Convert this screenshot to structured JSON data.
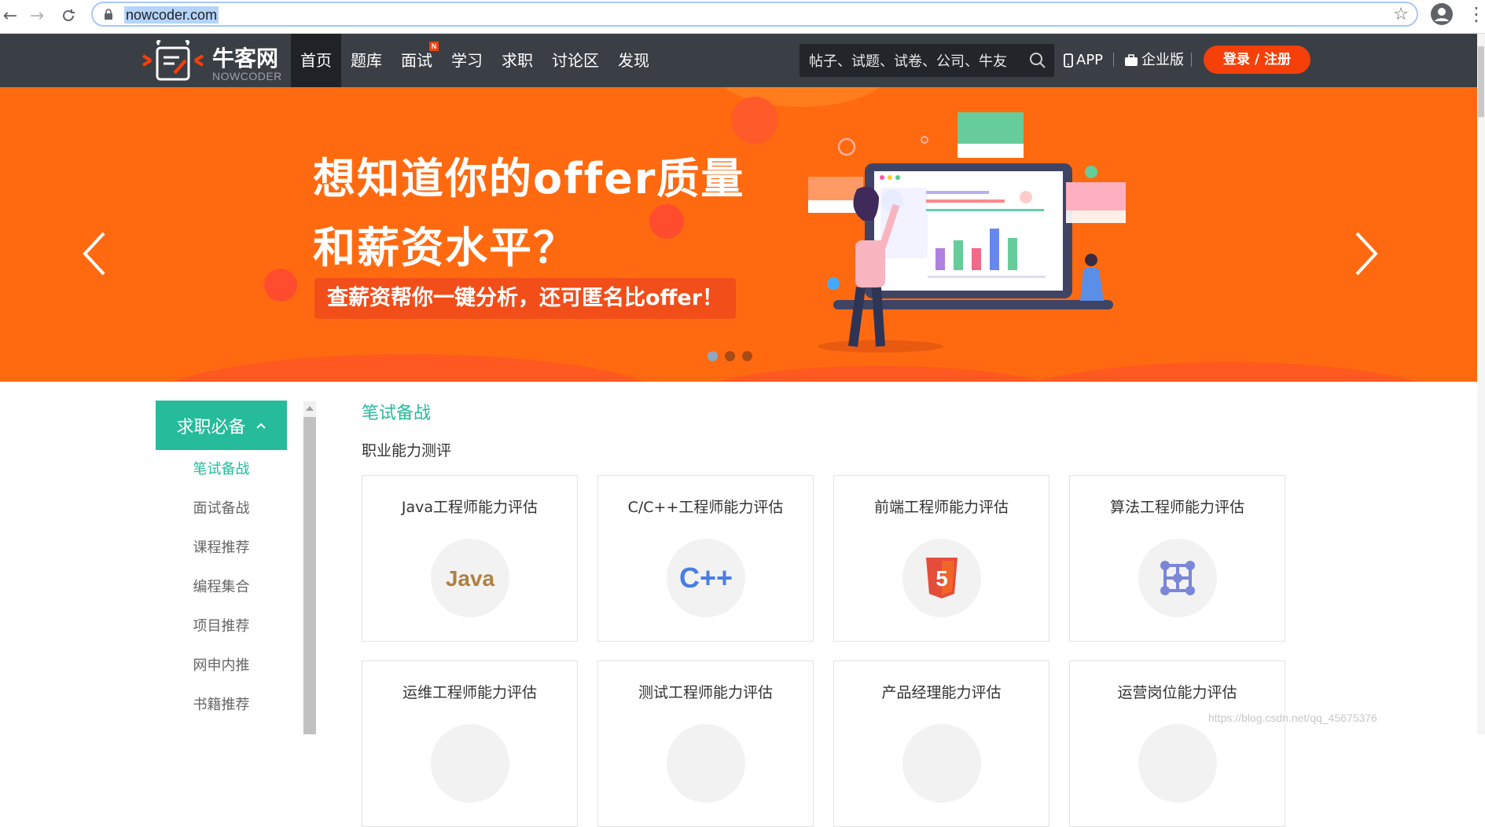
{
  "browser": {
    "url": "nowcoder.com"
  },
  "header": {
    "brand_cn": "牛客网",
    "brand_en": "NOWCODER",
    "nav": [
      {
        "label": "首页",
        "active": true
      },
      {
        "label": "题库"
      },
      {
        "label": "面试",
        "badge": "N"
      },
      {
        "label": "学习"
      },
      {
        "label": "求职"
      },
      {
        "label": "讨论区"
      },
      {
        "label": "发现"
      }
    ],
    "search_placeholder": "帖子、试题、试卷、公司、牛友",
    "app_label": "APP",
    "enterprise_label": "企业版",
    "login_label": "登录 / 注册"
  },
  "banner": {
    "headline_1": "想知道你的offer质量",
    "headline_2": "和薪资水平？",
    "cta": "查薪资帮你一键分析，还可匿名比offer！",
    "dots": 3,
    "active_dot": 0
  },
  "sidebar": {
    "section_title": "求职必备",
    "items": [
      {
        "label": "笔试备战",
        "active": true
      },
      {
        "label": "面试备战"
      },
      {
        "label": "课程推荐"
      },
      {
        "label": "编程集合"
      },
      {
        "label": "项目推荐"
      },
      {
        "label": "网申内推"
      },
      {
        "label": "书籍推荐"
      }
    ]
  },
  "content": {
    "section_title": "笔试备战",
    "subsection_title": "职业能力测评",
    "cards": [
      {
        "title": "Java工程师能力评估",
        "icon": "java-icon"
      },
      {
        "title": "C/C++工程师能力评估",
        "icon": "cpp-icon"
      },
      {
        "title": "前端工程师能力评估",
        "icon": "html5-icon"
      },
      {
        "title": "算法工程师能力评估",
        "icon": "algorithm-icon"
      },
      {
        "title": "运维工程师能力评估",
        "icon": "ops-icon"
      },
      {
        "title": "测试工程师能力评估",
        "icon": "test-icon"
      },
      {
        "title": "产品经理能力评估",
        "icon": "product-icon"
      },
      {
        "title": "运营岗位能力评估",
        "icon": "operation-icon"
      }
    ]
  },
  "watermark": "https://blog.csdn.net/qq_45675376",
  "colors": {
    "accent_green": "#25bb9b",
    "brand_orange": "#f5400a",
    "banner_bg": "#ff6a10",
    "header_bg": "#3a3f45"
  }
}
